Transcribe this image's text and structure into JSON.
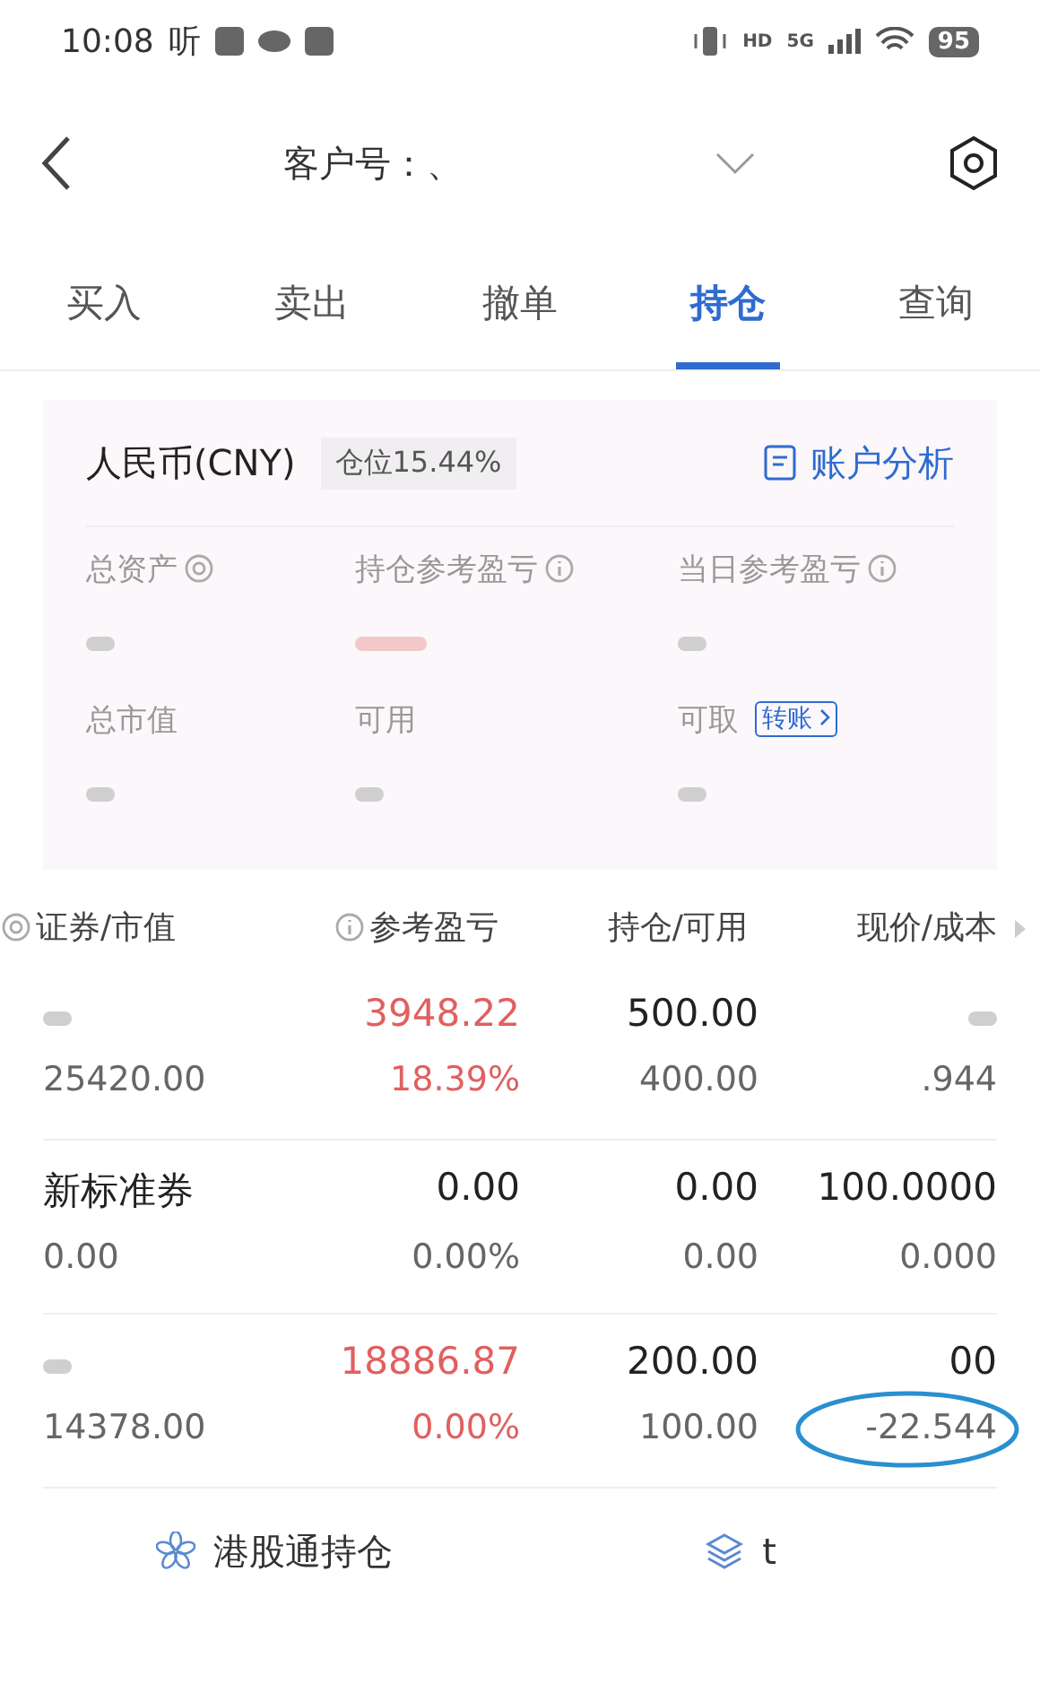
{
  "status_bar": {
    "time": "10:08",
    "app_glyph": "听",
    "network": "5G",
    "hd": "HD",
    "battery": "95"
  },
  "header": {
    "title": "客户号：、"
  },
  "tabs": [
    {
      "label": "买入",
      "selected": false
    },
    {
      "label": "卖出",
      "selected": false
    },
    {
      "label": "撤单",
      "selected": false
    },
    {
      "label": "持仓",
      "selected": true
    },
    {
      "label": "查询",
      "selected": false
    }
  ],
  "account": {
    "currency": "人民币(CNY)",
    "position": "仓位15.44%",
    "analysis_link": "账户分析",
    "metrics": [
      {
        "label": "总资产"
      },
      {
        "label": "持仓参考盈亏"
      },
      {
        "label": "当日参考盈亏"
      },
      {
        "label": "总市值"
      },
      {
        "label": "可用"
      },
      {
        "label": "可取",
        "transfer": "转账"
      }
    ]
  },
  "table": {
    "columns": [
      {
        "label": "证券/市值"
      },
      {
        "label": "参考盈亏"
      },
      {
        "label": "持仓/可用"
      },
      {
        "label": "现价/成本"
      }
    ],
    "rows": [
      {
        "name": "",
        "market_value": "25420.00",
        "pnl": "3948.22",
        "pnl_pct": "18.39%",
        "qty": "500.00",
        "avail": "400.00",
        "price": "",
        "cost": ".944",
        "kind": "gain",
        "circled": false
      },
      {
        "name": "新标准券",
        "market_value": "0.00",
        "pnl": "0.00",
        "pnl_pct": "0.00%",
        "qty": "0.00",
        "avail": "0.00",
        "price": "100.0000",
        "cost": "0.000",
        "kind": "flat",
        "circled": false
      },
      {
        "name": "",
        "market_value": "14378.00",
        "pnl": "18886.87",
        "pnl_pct": "0.00%",
        "qty": "200.00",
        "avail": "100.00",
        "price": "00",
        "cost": "-22.544",
        "kind": "gain",
        "circled": true
      }
    ]
  },
  "bottom_links": [
    {
      "label": "港股通持仓",
      "kind": "hk"
    },
    {
      "label": "t",
      "kind": "layers"
    }
  ]
}
